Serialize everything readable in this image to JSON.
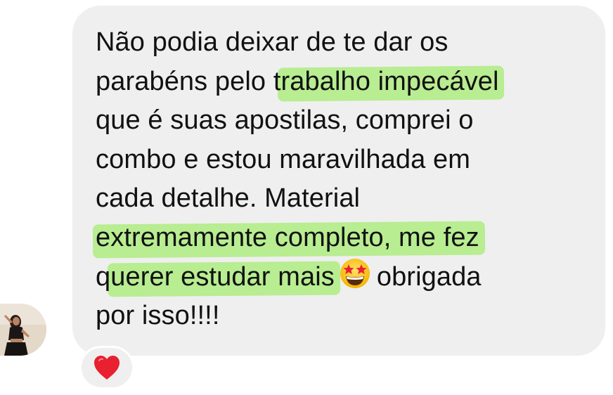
{
  "message": {
    "lines": [
      {
        "before": "Não podia deixar de te dar os",
        "highlight": "",
        "after": ""
      },
      {
        "before": "parabéns pelo t",
        "highlight": "rabalho impecável",
        "after": ""
      },
      {
        "before": "que é suas apostilas, comprei o",
        "highlight": "",
        "after": ""
      },
      {
        "before": "combo e estou maravilhada em",
        "highlight": "",
        "after": ""
      },
      {
        "before": "cada detalhe. Material",
        "highlight": "",
        "after": ""
      },
      {
        "before": "",
        "highlight": "extremamente completo, me fez",
        "after": ""
      },
      {
        "before": "q",
        "highlight": "uerer estudar mais",
        "after": ""
      },
      {
        "before": "por isso!!!!",
        "highlight": "",
        "after": ""
      }
    ],
    "line7_after_emoji": "obrigada",
    "emoji": "star-struck-emoji"
  },
  "reaction": {
    "icon": "red-heart-icon"
  },
  "avatar": {
    "icon": "profile-photo"
  },
  "colors": {
    "bubble": "#efefef",
    "highlight": "#a8ec76",
    "text": "#111111",
    "heart": "#e8202f"
  }
}
